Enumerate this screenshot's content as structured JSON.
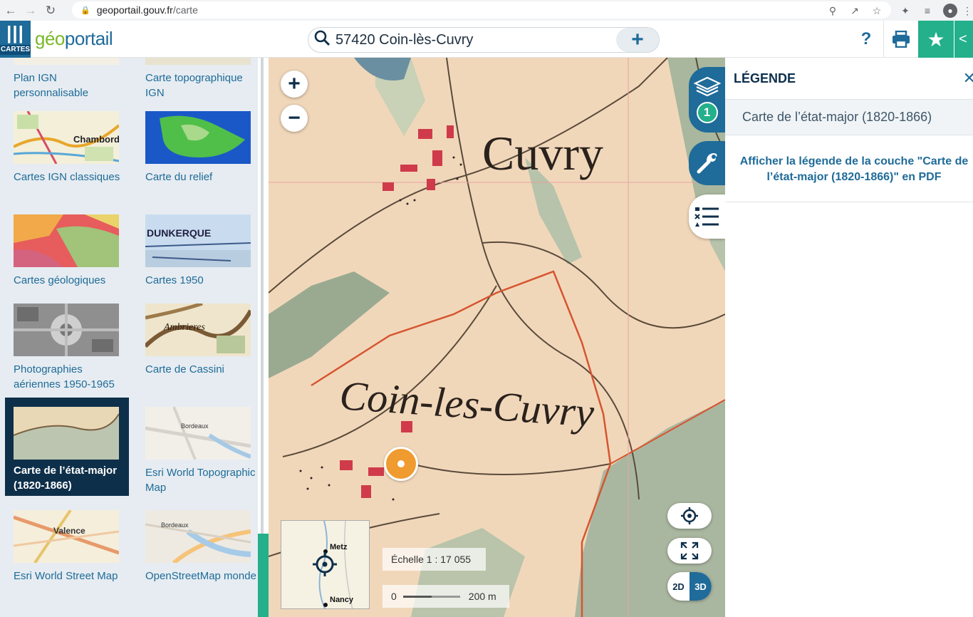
{
  "browser": {
    "url_domain": "geoportail.gouv.fr",
    "url_path": "/carte"
  },
  "header": {
    "menu_label": "CARTES",
    "logo_part1": "géo",
    "logo_part2": "portail",
    "search_value": "57420 Coin-lès-Cuvry",
    "help_label": "?"
  },
  "sidebar": {
    "tiles": [
      {
        "label": "Plan IGN personnalisable"
      },
      {
        "label": "Carte topographique IGN"
      },
      {
        "label": "Cartes IGN classiques",
        "thumb_text": "Chambord"
      },
      {
        "label": "Carte du relief"
      },
      {
        "label": "Cartes géologiques"
      },
      {
        "label": "Cartes 1950",
        "thumb_text": "DUNKERQUE"
      },
      {
        "label": "Photographies aériennes 1950-1965"
      },
      {
        "label": "Carte de Cassini",
        "thumb_text": "Ambrieres"
      },
      {
        "label": "Carte de l’état-major (1820-1866)",
        "selected": true
      },
      {
        "label": "Esri World Topographic Map",
        "thumb_text": "Bordeaux"
      },
      {
        "label": "Esri World Street Map",
        "thumb_text": "Valence"
      },
      {
        "label": "OpenStreetMap monde",
        "thumb_text": "Bordeaux"
      }
    ]
  },
  "map": {
    "labels": {
      "town1": "Cuvry",
      "town2": "Coin-les-Cuvry"
    },
    "layers_count": "1",
    "overview": {
      "city_top": "Metz",
      "city_bottom": "Nancy"
    },
    "scale_text": "Échelle 1 : 17 055",
    "scale_bar": {
      "start": "0",
      "end": "200 m"
    },
    "view_2d": "2D",
    "view_3d": "3D"
  },
  "legend": {
    "title": "LÉGENDE",
    "layer_name": "Carte de l’état-major (1820-1866)",
    "pdf_link": "Afficher la légende de la couche \"Carte de l’état-major (1820-1866)\" en PDF"
  },
  "colors": {
    "brand_blue": "#1f6b99",
    "brand_green": "#23b08a",
    "dark_navy": "#0e2f4a"
  }
}
